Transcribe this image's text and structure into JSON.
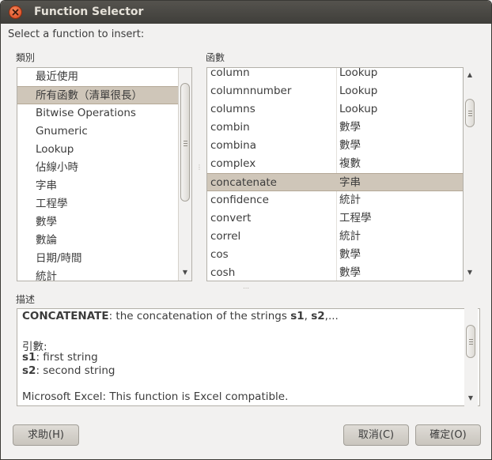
{
  "window": {
    "title": "Function Selector"
  },
  "prompt": "Select a function to insert:",
  "category_header": "類別",
  "function_header": "函數",
  "categories": [
    "最近使用",
    "所有函數（清單很長）",
    "Bitwise Operations",
    "Gnumeric",
    "Lookup",
    "佔線小時",
    "字串",
    "工程學",
    "數學",
    "數論",
    "日期/時間",
    "統計"
  ],
  "selected_category_index": 1,
  "functions": [
    {
      "name": "column",
      "category": "Lookup"
    },
    {
      "name": "columnnumber",
      "category": "Lookup"
    },
    {
      "name": "columns",
      "category": "Lookup"
    },
    {
      "name": "combin",
      "category": "數學"
    },
    {
      "name": "combina",
      "category": "數學"
    },
    {
      "name": "complex",
      "category": "複數"
    },
    {
      "name": "concatenate",
      "category": "字串"
    },
    {
      "name": "confidence",
      "category": "統計"
    },
    {
      "name": "convert",
      "category": "工程學"
    },
    {
      "name": "correl",
      "category": "統計"
    },
    {
      "name": "cos",
      "category": "數學"
    },
    {
      "name": "cosh",
      "category": "數學"
    }
  ],
  "selected_function_index": 6,
  "description_header": "描述",
  "description": {
    "fn_name": "CONCATENATE",
    "summary_mid": ": the concatenation of the strings ",
    "arg1_ref": "s1",
    "sep": ", ",
    "arg2_ref": "s2",
    "tail": ",...",
    "args_label": "引數:",
    "arg1_name": "s1",
    "arg1_text": ": first string",
    "arg2_name": "s2",
    "arg2_text": ": second string",
    "compat": "Microsoft Excel: This function is Excel compatible."
  },
  "buttons": {
    "help": "求助(H)",
    "cancel": "取消(C)",
    "ok": "確定(O)"
  },
  "icons": {
    "close": "close-icon",
    "scroll_up": "scroll-up-arrow-icon",
    "scroll_down": "scroll-down-arrow-icon"
  },
  "colors": {
    "titlebar": "#3f3e3a",
    "selection": "#cfc6b9",
    "close": "#d8431c"
  }
}
